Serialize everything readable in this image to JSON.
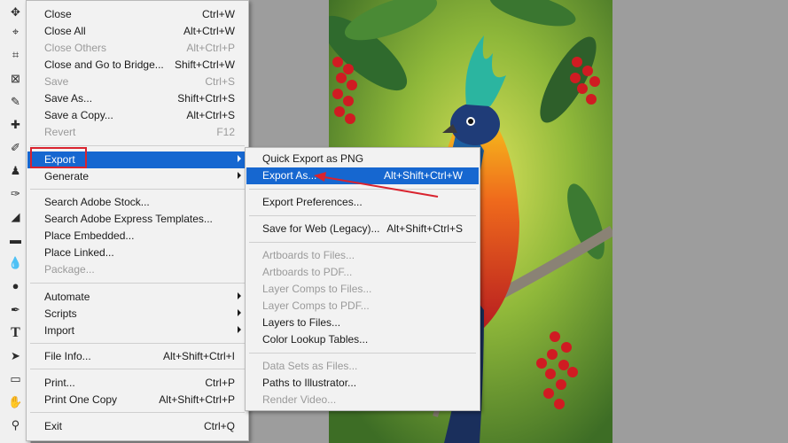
{
  "file_menu": {
    "items": [
      {
        "label": "Close",
        "shortcut": "Ctrl+W"
      },
      {
        "label": "Close All",
        "shortcut": "Alt+Ctrl+W"
      },
      {
        "label": "Close Others",
        "shortcut": "Alt+Ctrl+P"
      },
      {
        "label": "Close and Go to Bridge...",
        "shortcut": "Shift+Ctrl+W"
      },
      {
        "label": "Save",
        "shortcut": "Ctrl+S"
      },
      {
        "label": "Save As...",
        "shortcut": "Shift+Ctrl+S"
      },
      {
        "label": "Save a Copy...",
        "shortcut": "Alt+Ctrl+S"
      },
      {
        "label": "Revert",
        "shortcut": "F12"
      },
      {
        "label": "Export"
      },
      {
        "label": "Generate"
      },
      {
        "label": "Search Adobe Stock..."
      },
      {
        "label": "Search Adobe Express Templates..."
      },
      {
        "label": "Place Embedded..."
      },
      {
        "label": "Place Linked..."
      },
      {
        "label": "Package..."
      },
      {
        "label": "Automate"
      },
      {
        "label": "Scripts"
      },
      {
        "label": "Import"
      },
      {
        "label": "File Info...",
        "shortcut": "Alt+Shift+Ctrl+I"
      },
      {
        "label": "Print...",
        "shortcut": "Ctrl+P"
      },
      {
        "label": "Print One Copy",
        "shortcut": "Alt+Shift+Ctrl+P"
      },
      {
        "label": "Exit",
        "shortcut": "Ctrl+Q"
      }
    ]
  },
  "export_menu": {
    "items": [
      {
        "label": "Quick Export as PNG"
      },
      {
        "label": "Export As...",
        "shortcut": "Alt+Shift+Ctrl+W"
      },
      {
        "label": "Export Preferences..."
      },
      {
        "label": "Save for Web (Legacy)...",
        "shortcut": "Alt+Shift+Ctrl+S"
      },
      {
        "label": "Artboards to Files..."
      },
      {
        "label": "Artboards to PDF..."
      },
      {
        "label": "Layer Comps to Files..."
      },
      {
        "label": "Layer Comps to PDF..."
      },
      {
        "label": "Layers to Files..."
      },
      {
        "label": "Color Lookup Tables..."
      },
      {
        "label": "Data Sets as Files..."
      },
      {
        "label": "Paths to Illustrator..."
      },
      {
        "label": "Render Video..."
      }
    ]
  },
  "colors": {
    "highlight": "#1667d0",
    "annotation": "#d9232e",
    "menu_bg": "#f2f2f2"
  }
}
